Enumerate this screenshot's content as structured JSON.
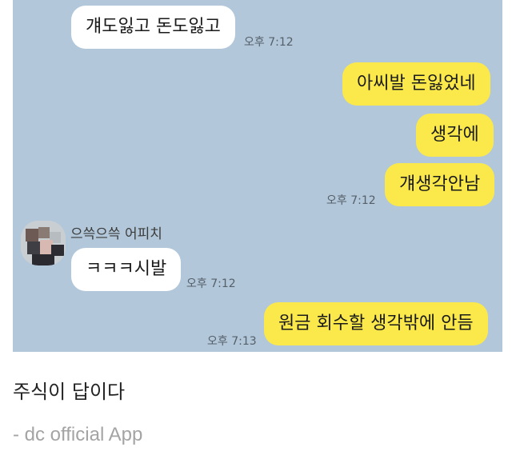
{
  "chat": {
    "messages": [
      {
        "text": "걔도잃고 돈도잃고",
        "direction": "incoming",
        "time": "오후 7:12"
      },
      {
        "text": "아씨발 돈잃었네",
        "direction": "outgoing"
      },
      {
        "text": "생각에",
        "direction": "outgoing"
      },
      {
        "text": "걔생각안남",
        "direction": "outgoing",
        "time": "오후 7:12"
      },
      {
        "text": "ㅋㅋㅋ시발",
        "direction": "incoming",
        "sender": "으쓱으쓱 어피치",
        "time": "오후 7:12"
      },
      {
        "text": "원금 회수할 생각밖에 안듬",
        "direction": "outgoing",
        "time": "오후 7:13"
      }
    ],
    "colors": {
      "background": "#b2c7d9",
      "incoming_bubble": "#ffffff",
      "outgoing_bubble": "#fbe94c"
    },
    "avatar_icon": "blurred-profile-photo"
  },
  "post": {
    "caption": "주식이 답이다",
    "signature": "- dc official App"
  }
}
